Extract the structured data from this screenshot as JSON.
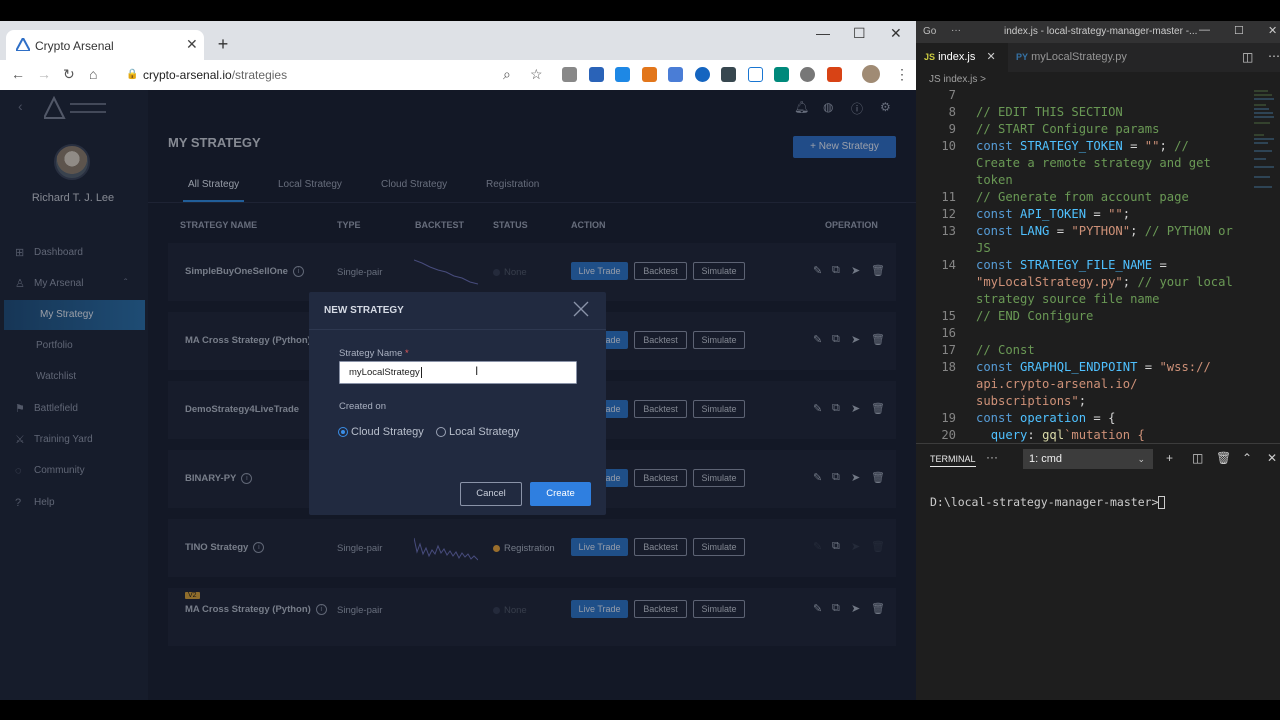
{
  "browser": {
    "tab_title": "Crypto Arsenal",
    "url_host": "crypto-arsenal.io",
    "url_path": "/strategies"
  },
  "sidebar": {
    "user_name": "Richard T. J. Lee",
    "items": [
      {
        "label": "Dashboard",
        "icon": "dashboard-icon"
      },
      {
        "label": "My Arsenal",
        "icon": "user-icon"
      },
      {
        "label": "My Strategy"
      },
      {
        "label": "Portfolio"
      },
      {
        "label": "Watchlist"
      },
      {
        "label": "Battlefield",
        "icon": "flag-icon"
      },
      {
        "label": "Training Yard",
        "icon": "training-icon"
      },
      {
        "label": "Community",
        "icon": "chat-icon"
      },
      {
        "label": "Help",
        "icon": "help-icon"
      }
    ]
  },
  "main": {
    "title": "MY STRATEGY",
    "new_button": "+ New Strategy",
    "tabs": [
      "All Strategy",
      "Local Strategy",
      "Cloud Strategy",
      "Registration"
    ],
    "columns": [
      "STRATEGY NAME",
      "TYPE",
      "BACKTEST",
      "STATUS",
      "ACTION",
      "OPERATION"
    ],
    "actions": {
      "live": "Live Trade",
      "backtest": "Backtest",
      "simulate": "Simulate"
    },
    "rows": [
      {
        "name": "SimpleBuyOneSellOne",
        "type": "Single-pair",
        "status": "None"
      },
      {
        "name": "MA Cross Strategy (Python)",
        "type": "",
        "status": ""
      },
      {
        "name": "DemoStrategy4LiveTrade",
        "type": "",
        "status": ""
      },
      {
        "name": "BINARY-PY",
        "type": "",
        "status": ""
      },
      {
        "name": "TINO Strategy",
        "type": "Single-pair",
        "status": "Registration"
      },
      {
        "name": "MA Cross Strategy (Python)",
        "type": "Single-pair",
        "status": "None",
        "badge": "V2"
      }
    ],
    "status_colors": {
      "registration": "#e8a33a",
      "none": "#3a4257"
    }
  },
  "dialog": {
    "title": "NEW STRATEGY",
    "field_label": "Strategy Name",
    "required_mark": "*",
    "field_value": "myLocalStrategy",
    "created_on_label": "Created on",
    "options": [
      "Cloud Strategy",
      "Local Strategy"
    ],
    "selected_option": "Cloud Strategy",
    "cancel": "Cancel",
    "create": "Create"
  },
  "editor": {
    "menu_go": "Go",
    "window_title": "index.js - local-strategy-manager-master -...",
    "tabs": [
      "index.js",
      "myLocalStrategy.py"
    ],
    "tab_badges": [
      "JS",
      "PY"
    ],
    "breadcrumb": "JS  index.js >",
    "lines": [
      {
        "n": "7",
        "html": ""
      },
      {
        "n": "8",
        "html": "<span class='cm'>// EDIT THIS SECTION</span>"
      },
      {
        "n": "9",
        "html": "<span class='cm'>// START Configure params</span>"
      },
      {
        "n": "10",
        "html": "<span class='kw'>const</span> <span class='vr'>STRATEGY_TOKEN</span> = <span class='st'>\"\"</span>; <span class='cm'>//</span>"
      },
      {
        "n": "",
        "html": "<span class='cm'>Create a remote strategy and get</span>"
      },
      {
        "n": "",
        "html": "<span class='cm'>token</span>"
      },
      {
        "n": "11",
        "html": "<span class='cm'>// Generate from account page</span>"
      },
      {
        "n": "12",
        "html": "<span class='kw'>const</span> <span class='vr'>API_TOKEN</span> = <span class='st'>\"\"</span>;"
      },
      {
        "n": "13",
        "html": "<span class='kw'>const</span> <span class='vr'>LANG</span> = <span class='st'>\"PYTHON\"</span>; <span class='cm'>// PYTHON or</span>"
      },
      {
        "n": "",
        "html": "<span class='cm'>JS</span>"
      },
      {
        "n": "14",
        "html": "<span class='kw'>const</span> <span class='vr'>STRATEGY_FILE_NAME</span> ="
      },
      {
        "n": "",
        "html": "<span class='st'>\"myLocalStrategy.py\"</span>; <span class='cm'>// your local</span>"
      },
      {
        "n": "",
        "html": "<span class='cm'>strategy source file name</span>"
      },
      {
        "n": "15",
        "html": "<span class='cm'>// END Configure</span>"
      },
      {
        "n": "16",
        "html": ""
      },
      {
        "n": "17",
        "html": "<span class='cm'>// Const</span>"
      },
      {
        "n": "18",
        "html": "<span class='kw'>const</span> <span class='vr'>GRAPHQL_ENDPOINT</span> = <span class='st'>\"wss://</span>"
      },
      {
        "n": "",
        "html": "<span class='st'>api.crypto-arsenal.io/</span>"
      },
      {
        "n": "",
        "html": "<span class='st'>subscriptions\"</span>;"
      },
      {
        "n": "19",
        "html": "<span class='kw'>const</span> <span class='vr'>operation</span> = {"
      },
      {
        "n": "20",
        "html": "  <span class='vr'>query</span>: <span class='fn'>gql</span><span class='st'>`mutation {</span>"
      }
    ],
    "terminal_label": "TERMINAL",
    "terminal_select": "1: cmd",
    "terminal_prompt": "D:\\local-strategy-manager-master>"
  }
}
